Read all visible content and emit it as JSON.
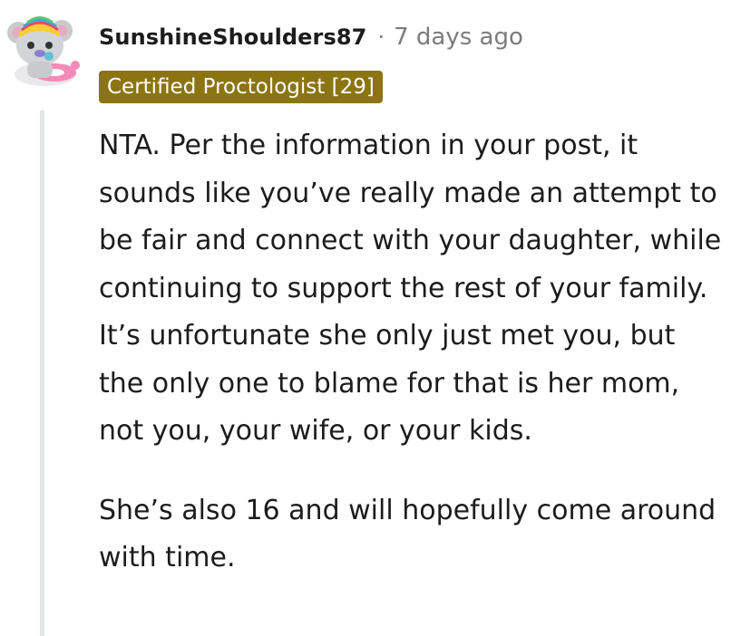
{
  "comment": {
    "username": "SunshineShoulders87",
    "separator": "·",
    "timestamp": "7 days ago",
    "flair": "Certified Proctologist [29]",
    "avatar_icon": "koala-avatar-icon",
    "paragraphs": [
      "NTA. Per the information in your post, it sounds like you’ve really made an attempt to be fair and connect with your daughter, while continuing to support the rest of your family. It’s unfortunate she only just met you, but the only one to blame for that is her mom, not you, your wife, or your kids.",
      "She’s also 16 and will hopefully come around with time."
    ]
  },
  "colors": {
    "flair_bg": "#8b7412",
    "text": "#1c1c1c",
    "meta": "#7c7c7c",
    "thread_line": "#e4e5e6"
  }
}
